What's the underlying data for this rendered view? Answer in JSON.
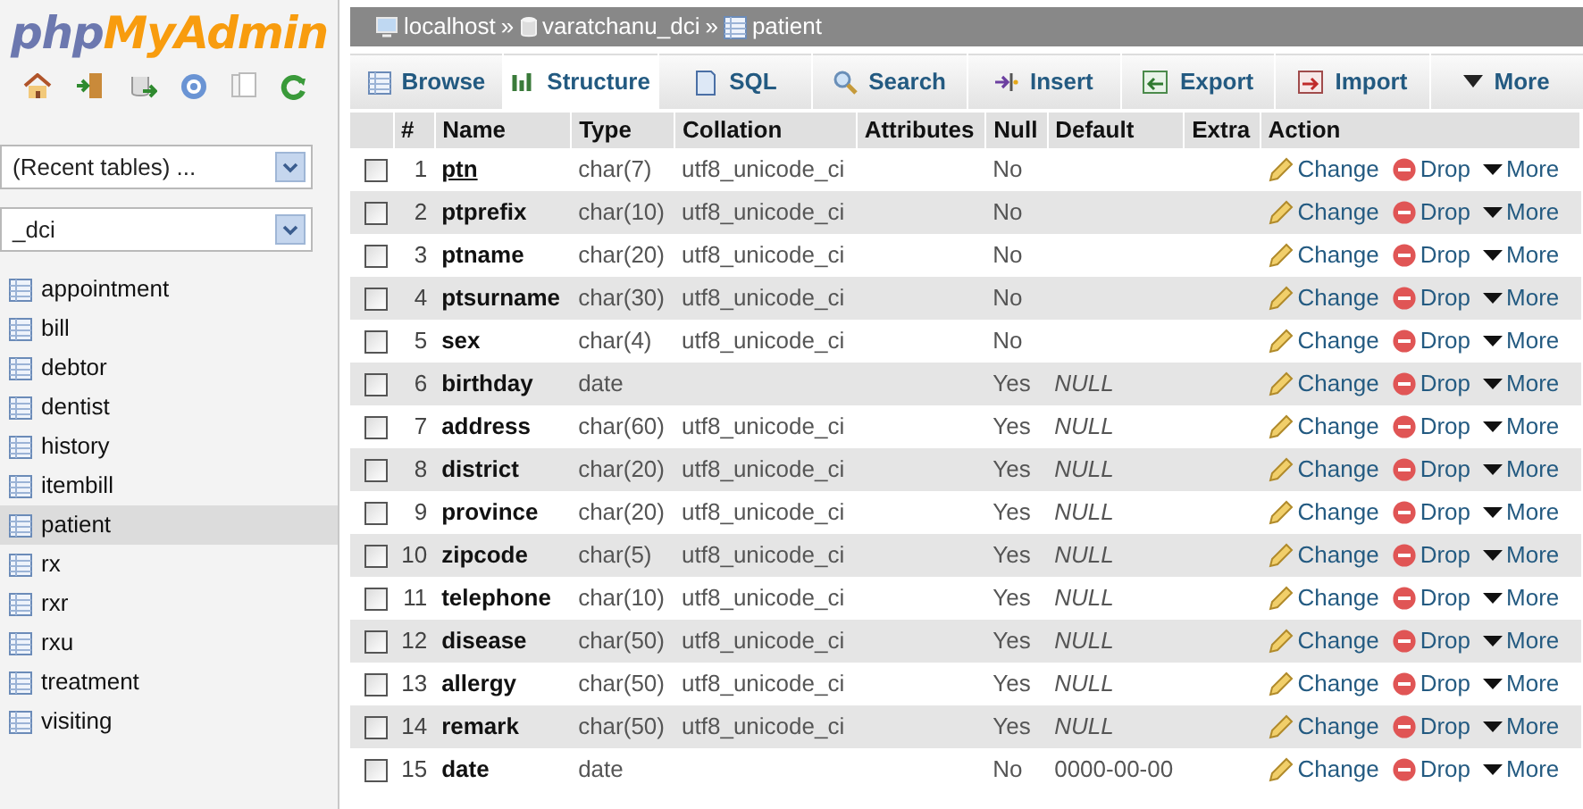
{
  "logo": {
    "part1": "php",
    "part2": "MyAdmin"
  },
  "recent_select": {
    "value": "(Recent tables) ..."
  },
  "database_select": {
    "value": "_dci"
  },
  "tables": [
    {
      "name": "appointment",
      "selected": false
    },
    {
      "name": "bill",
      "selected": false
    },
    {
      "name": "debtor",
      "selected": false
    },
    {
      "name": "dentist",
      "selected": false
    },
    {
      "name": "history",
      "selected": false
    },
    {
      "name": "itembill",
      "selected": false
    },
    {
      "name": "patient",
      "selected": true
    },
    {
      "name": "rx",
      "selected": false
    },
    {
      "name": "rxr",
      "selected": false
    },
    {
      "name": "rxu",
      "selected": false
    },
    {
      "name": "treatment",
      "selected": false
    },
    {
      "name": "visiting",
      "selected": false
    }
  ],
  "breadcrumb": [
    {
      "label": "localhost",
      "kind": "server"
    },
    {
      "label": "varatchanu_dci",
      "kind": "database"
    },
    {
      "label": "patient",
      "kind": "table"
    }
  ],
  "breadcrumb_separator": "»",
  "tabs": [
    {
      "label": "Browse",
      "kind": "browse",
      "selected": false
    },
    {
      "label": "Structure",
      "kind": "structure",
      "selected": true
    },
    {
      "label": "SQL",
      "kind": "sql",
      "selected": false
    },
    {
      "label": "Search",
      "kind": "search",
      "selected": false
    },
    {
      "label": "Insert",
      "kind": "insert",
      "selected": false
    },
    {
      "label": "Export",
      "kind": "export",
      "selected": false
    },
    {
      "label": "Import",
      "kind": "import",
      "selected": false
    },
    {
      "label": "More",
      "kind": "more",
      "selected": false
    }
  ],
  "table": {
    "columns": [
      "#",
      "Name",
      "Type",
      "Collation",
      "Attributes",
      "Null",
      "Default",
      "Extra",
      "Action"
    ],
    "rows": [
      {
        "num": "1",
        "name": "ptn",
        "primary": true,
        "type": "char(7)",
        "collation": "utf8_unicode_ci",
        "null": "No",
        "checked": false,
        "actions": [
          "Change",
          "Drop",
          "More"
        ]
      },
      {
        "num": "2",
        "name": "ptprefix",
        "primary": false,
        "type": "char(10)",
        "collation": "utf8_unicode_ci",
        "null": "No",
        "checked": false,
        "actions": [
          "Change",
          "Drop",
          "More"
        ]
      },
      {
        "num": "3",
        "name": "ptname",
        "primary": false,
        "type": "char(20)",
        "collation": "utf8_unicode_ci",
        "null": "No",
        "checked": false,
        "actions": [
          "Change",
          "Drop",
          "More"
        ]
      },
      {
        "num": "4",
        "name": "ptsurname",
        "primary": false,
        "type": "char(30)",
        "collation": "utf8_unicode_ci",
        "null": "No",
        "checked": false,
        "actions": [
          "Change",
          "Drop",
          "More"
        ]
      },
      {
        "num": "5",
        "name": "sex",
        "primary": false,
        "type": "char(4)",
        "collation": "utf8_unicode_ci",
        "null": "No",
        "checked": false,
        "actions": [
          "Change",
          "Drop",
          "More"
        ]
      },
      {
        "num": "6",
        "name": "birthday",
        "primary": false,
        "type": "date",
        "null": "Yes",
        "default": "NULL",
        "default_italic": true,
        "checked": false,
        "actions": [
          "Change",
          "Drop",
          "More"
        ]
      },
      {
        "num": "7",
        "name": "address",
        "primary": false,
        "type": "char(60)",
        "collation": "utf8_unicode_ci",
        "null": "Yes",
        "default": "NULL",
        "default_italic": true,
        "checked": false,
        "actions": [
          "Change",
          "Drop",
          "More"
        ]
      },
      {
        "num": "8",
        "name": "district",
        "primary": false,
        "type": "char(20)",
        "collation": "utf8_unicode_ci",
        "null": "Yes",
        "default": "NULL",
        "default_italic": true,
        "checked": false,
        "actions": [
          "Change",
          "Drop",
          "More"
        ]
      },
      {
        "num": "9",
        "name": "province",
        "primary": false,
        "type": "char(20)",
        "collation": "utf8_unicode_ci",
        "null": "Yes",
        "default": "NULL",
        "default_italic": true,
        "checked": false,
        "actions": [
          "Change",
          "Drop",
          "More"
        ]
      },
      {
        "num": "10",
        "name": "zipcode",
        "primary": false,
        "type": "char(5)",
        "collation": "utf8_unicode_ci",
        "null": "Yes",
        "default": "NULL",
        "default_italic": true,
        "checked": false,
        "actions": [
          "Change",
          "Drop",
          "More"
        ]
      },
      {
        "num": "11",
        "name": "telephone",
        "primary": false,
        "type": "char(10)",
        "collation": "utf8_unicode_ci",
        "null": "Yes",
        "default": "NULL",
        "default_italic": true,
        "checked": false,
        "actions": [
          "Change",
          "Drop",
          "More"
        ]
      },
      {
        "num": "12",
        "name": "disease",
        "primary": false,
        "type": "char(50)",
        "collation": "utf8_unicode_ci",
        "null": "Yes",
        "default": "NULL",
        "default_italic": true,
        "checked": false,
        "actions": [
          "Change",
          "Drop",
          "More"
        ]
      },
      {
        "num": "13",
        "name": "allergy",
        "primary": false,
        "type": "char(50)",
        "collation": "utf8_unicode_ci",
        "null": "Yes",
        "default": "NULL",
        "default_italic": true,
        "checked": false,
        "actions": [
          "Change",
          "Drop",
          "More"
        ]
      },
      {
        "num": "14",
        "name": "remark",
        "primary": false,
        "type": "char(50)",
        "collation": "utf8_unicode_ci",
        "null": "Yes",
        "default": "NULL",
        "default_italic": true,
        "checked": false,
        "actions": [
          "Change",
          "Drop",
          "More"
        ]
      },
      {
        "num": "15",
        "name": "date",
        "primary": false,
        "type": "date",
        "null": "No",
        "default": "0000-00-00",
        "default_italic": false,
        "checked": false,
        "actions": [
          "Change",
          "Drop",
          "More"
        ]
      }
    ]
  }
}
